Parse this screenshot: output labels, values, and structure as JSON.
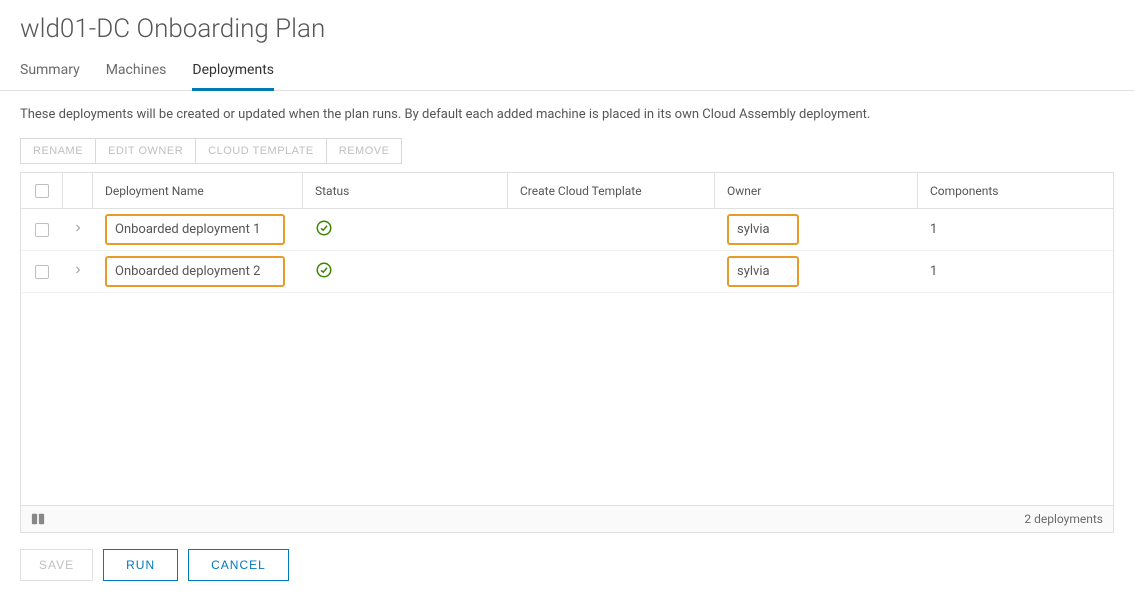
{
  "page": {
    "title": "wld01-DC Onboarding Plan"
  },
  "tabs": [
    {
      "label": "Summary",
      "active": false
    },
    {
      "label": "Machines",
      "active": false
    },
    {
      "label": "Deployments",
      "active": true
    }
  ],
  "description": "These deployments will be created or updated when the plan runs. By default each added machine is placed in its own Cloud Assembly deployment.",
  "actions": {
    "rename": "RENAME",
    "edit_owner": "EDIT OWNER",
    "cloud_template": "CLOUD TEMPLATE",
    "remove": "REMOVE"
  },
  "table": {
    "headers": {
      "name": "Deployment Name",
      "status": "Status",
      "template": "Create Cloud Template",
      "owner": "Owner",
      "components": "Components"
    },
    "rows": [
      {
        "name": "Onboarded deployment 1",
        "status": "ok",
        "template": "",
        "owner": "sylvia",
        "components": "1"
      },
      {
        "name": "Onboarded deployment 2",
        "status": "ok",
        "template": "",
        "owner": "sylvia",
        "components": "1"
      }
    ],
    "footer_count": "2 deployments"
  },
  "buttons": {
    "save": "SAVE",
    "run": "RUN",
    "cancel": "CANCEL"
  }
}
